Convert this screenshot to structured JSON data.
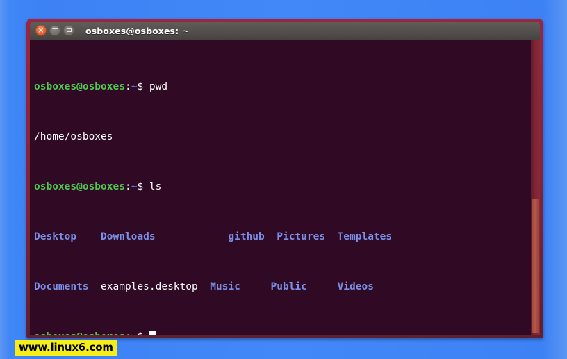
{
  "desktop": {
    "background_color": "#3d82f5"
  },
  "window": {
    "title": "osboxes@osboxes: ~",
    "frame_color": "#8e2540",
    "buttons": {
      "close": {
        "name": "close",
        "glyph": "×",
        "color": "#e2683a"
      },
      "minimize": {
        "name": "minimize",
        "glyph": "−",
        "color": "#7a7672"
      },
      "maximize": {
        "name": "maximize",
        "glyph": "□",
        "color": "#7a7672"
      }
    }
  },
  "terminal": {
    "background_color": "#300a24",
    "foreground_color": "#ffffff",
    "prompt_color": "#4ec94e",
    "directory_color": "#7a90e8",
    "prompt": {
      "user_host": "osboxes@osboxes",
      "colon": ":",
      "path": "~",
      "sigil": "$"
    },
    "lines": [
      {
        "type": "prompt",
        "command": "pwd"
      },
      {
        "type": "output",
        "text": "/home/osboxes"
      },
      {
        "type": "prompt",
        "command": "ls"
      },
      {
        "type": "listing",
        "columns": [
          "Desktop",
          "Downloads",
          "github",
          "Pictures",
          "Templates"
        ]
      },
      {
        "type": "listing",
        "columns": [
          "Documents",
          "examples.desktop",
          "Music",
          "Public",
          "Videos"
        ]
      },
      {
        "type": "prompt",
        "command": "",
        "cursor": true
      }
    ],
    "listing_row1": {
      "col1": "Desktop",
      "col2": "Downloads",
      "col3": "github",
      "col4": "Pictures",
      "col5": "Templates"
    },
    "listing_row2": {
      "col1": "Documents",
      "col2": "examples.desktop",
      "col3": "Music",
      "col4": "Public",
      "col5": "Videos"
    },
    "pwd_command": "pwd",
    "pwd_output": "/home/osboxes",
    "ls_command": "ls",
    "empty_command": ""
  },
  "scrollbar": {
    "orientation": "vertical",
    "thumb_color": "#b4584a",
    "track_color": "#7d2433"
  },
  "watermark": {
    "text": "www.linux6.com",
    "background_color": "#f5ee18",
    "text_color": "#000000"
  }
}
